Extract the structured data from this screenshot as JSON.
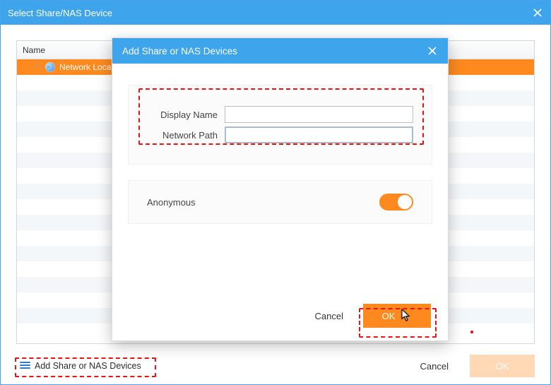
{
  "outer": {
    "title": "Select Share/NAS Device",
    "tree": {
      "header": "Name",
      "selected_item": "Network Location"
    },
    "footer": {
      "add_link": "Add Share or NAS Devices",
      "cancel": "Cancel",
      "ok": "OK"
    }
  },
  "modal": {
    "title": "Add Share or NAS Devices",
    "form": {
      "display_name_label": "Display Name",
      "display_name_value": "",
      "network_path_label": "Network Path",
      "network_path_value": ""
    },
    "anonymous": {
      "label": "Anonymous",
      "enabled": true
    },
    "buttons": {
      "cancel": "Cancel",
      "ok": "OK"
    }
  },
  "colors": {
    "accent_blue": "#3ea4ec",
    "accent_orange": "#fe8a1f",
    "highlight_red": "#e11"
  }
}
